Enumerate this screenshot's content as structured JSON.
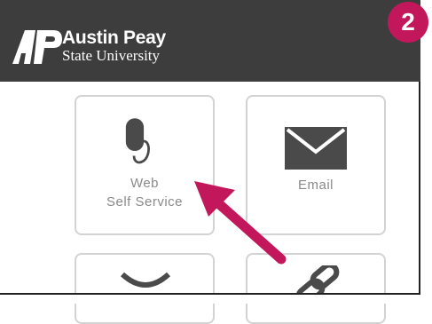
{
  "header": {
    "logo_line1": "Austin Peay",
    "logo_line2": "State University"
  },
  "step_badge": "2",
  "tiles": [
    {
      "label_line1": "Web",
      "label_line2": "Self Service",
      "icon": "mouse-icon"
    },
    {
      "label_line1": "Email",
      "icon": "envelope-icon"
    },
    {
      "icon": "hourglass-icon"
    },
    {
      "icon": "chain-link-icon"
    }
  ],
  "colors": {
    "header_bg": "#3d3d3d",
    "badge_bg": "#c2185b",
    "arrow": "#c2185b",
    "icon": "#4a4a4a",
    "tile_border": "#d3d3d3",
    "label": "#8a8a8a"
  }
}
